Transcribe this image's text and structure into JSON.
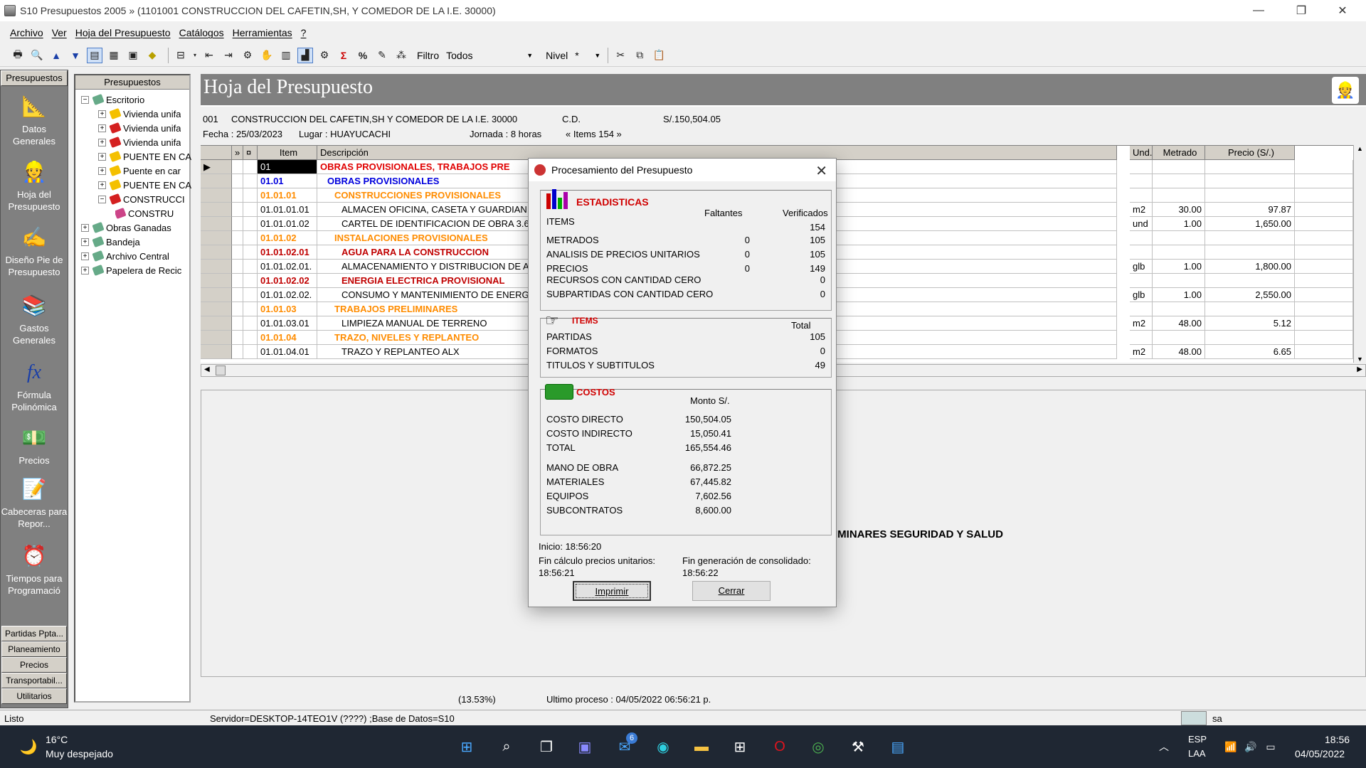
{
  "window": {
    "title": "S10 Presupuestos 2005 » (1101001 CONSTRUCCION DEL CAFETIN,SH, Y COMEDOR DE LA I.E. 30000)",
    "minimize": "—",
    "restore": "❐",
    "close": "✕"
  },
  "menu": [
    "Archivo",
    "Ver",
    "Hoja del Presupuesto",
    "Catálogos",
    "Herramientas",
    "?"
  ],
  "toolbar": {
    "filtro_label": "Filtro",
    "filtro_value": "Todos",
    "nivel_label": "Nivel",
    "nivel_value": "*"
  },
  "leftnav": {
    "header": "Presupuestos",
    "items": [
      {
        "label": "Datos Generales",
        "icon": "ruler-icon"
      },
      {
        "label": "Hoja del Presupuesto",
        "icon": "worker-icon"
      },
      {
        "label": "Diseño Pie de Presupuesto",
        "icon": "design-icon"
      },
      {
        "label": "Gastos Generales",
        "icon": "books-icon"
      },
      {
        "label": "Fórmula Polinómica",
        "icon": "formula-icon"
      },
      {
        "label": "Precios",
        "icon": "money-icon"
      },
      {
        "label": "Cabeceras para Repor...",
        "icon": "note-icon"
      },
      {
        "label": "Tiempos para Programació",
        "icon": "clock-icon"
      }
    ],
    "buttons": [
      "Partidas Ppta...",
      "Planeamiento",
      "Precios",
      "Transportabil...",
      "Utilitarios"
    ]
  },
  "tree": {
    "header": "Presupuestos",
    "items": [
      {
        "label": "Escritorio",
        "level": 0,
        "toggle": "−"
      },
      {
        "label": "Vivienda unifa",
        "level": 1,
        "toggle": "+"
      },
      {
        "label": "Vivienda unifa",
        "level": 1,
        "toggle": "+"
      },
      {
        "label": "Vivienda unifa",
        "level": 1,
        "toggle": "+"
      },
      {
        "label": "PUENTE EN CA",
        "level": 1,
        "toggle": "+"
      },
      {
        "label": "Puente en car",
        "level": 1,
        "toggle": "+"
      },
      {
        "label": "PUENTE EN CA",
        "level": 1,
        "toggle": "+"
      },
      {
        "label": "CONSTRUCCI",
        "level": 1,
        "toggle": "−"
      },
      {
        "label": "CONSTRU",
        "level": 2,
        "toggle": ""
      },
      {
        "label": "Obras Ganadas",
        "level": 0,
        "toggle": "+"
      },
      {
        "label": "Bandeja",
        "level": 0,
        "toggle": "+"
      },
      {
        "label": "Archivo Central",
        "level": 0,
        "toggle": "+"
      },
      {
        "label": "Papelera de Recic",
        "level": 0,
        "toggle": "+"
      }
    ]
  },
  "main": {
    "title": "Hoja del Presupuesto",
    "code": "001",
    "name": "CONSTRUCCION DEL CAFETIN,SH Y COMEDOR DE LA I.E. 30000",
    "cd": "C.D.",
    "amount": "S/.150,504.05",
    "fecha": "Fecha : 25/03/2023",
    "lugar": "Lugar :  HUAYUCACHI",
    "jornada": "Jornada :  8    horas",
    "items": "« Items 154 »",
    "columns": [
      "»",
      "¤",
      "Item",
      "Descripción",
      "Und.",
      "Metrado",
      "Precio (S/.)"
    ],
    "rows": [
      {
        "item": "01",
        "desc": "OBRAS PROVISIONALES, TRABAJOS PRE",
        "und": "",
        "met": "",
        "pre": "",
        "style": "c-red"
      },
      {
        "item": "01.01",
        "desc": "OBRAS PROVISIONALES",
        "und": "",
        "met": "",
        "pre": "",
        "style": "c-blue"
      },
      {
        "item": "01.01.01",
        "desc": "CONSTRUCCIONES PROVISIONALES",
        "und": "",
        "met": "",
        "pre": "",
        "style": "c-orange"
      },
      {
        "item": "01.01.01.01",
        "desc": "ALMACEN OFICINA, CASETA Y GUARDIAN",
        "und": "m2",
        "met": "30.00",
        "pre": "97.87",
        "style": ""
      },
      {
        "item": "01.01.01.02",
        "desc": "CARTEL DE IDENTIFICACION DE OBRA 3.60",
        "und": "und",
        "met": "1.00",
        "pre": "1,650.00",
        "style": ""
      },
      {
        "item": "01.01.02",
        "desc": "INSTALACIONES PROVISIONALES",
        "und": "",
        "met": "",
        "pre": "",
        "style": "c-orange"
      },
      {
        "item": "01.01.02.01",
        "desc": "AGUA PARA LA CONSTRUCCION",
        "und": "",
        "met": "",
        "pre": "",
        "style": "c-darkred"
      },
      {
        "item": "01.01.02.01.",
        "desc": "ALMACENAMIENTO Y DISTRIBUCION DE A",
        "und": "glb",
        "met": "1.00",
        "pre": "1,800.00",
        "style": ""
      },
      {
        "item": "01.01.02.02",
        "desc": "ENERGIA ELECTRICA PROVISIONAL",
        "und": "",
        "met": "",
        "pre": "",
        "style": "c-darkred"
      },
      {
        "item": "01.01.02.02.",
        "desc": "CONSUMO Y MANTENIMIENTO DE ENERG",
        "und": "glb",
        "met": "1.00",
        "pre": "2,550.00",
        "style": ""
      },
      {
        "item": "01.01.03",
        "desc": "TRABAJOS PRELIMINARES",
        "und": "",
        "met": "",
        "pre": "",
        "style": "c-orange"
      },
      {
        "item": "01.01.03.01",
        "desc": "LIMPIEZA MANUAL DE TERRENO",
        "und": "m2",
        "met": "48.00",
        "pre": "5.12",
        "style": ""
      },
      {
        "item": "01.01.04",
        "desc": "TRAZO, NIVELES Y REPLANTEO",
        "und": "",
        "met": "",
        "pre": "",
        "style": "c-orange"
      },
      {
        "item": "01.01.04.01",
        "desc": "TRAZO Y REPLANTEO ALX",
        "und": "m2",
        "met": "48.00",
        "pre": "6.65",
        "style": ""
      }
    ],
    "lower_text": "IMINARES SEGURIDAD Y SALUD",
    "percent": "(13.53%)",
    "ultimo": "Ultimo proceso : 04/05/2022 06:56:21 p."
  },
  "status": {
    "left": "Listo",
    "server": "Servidor=DESKTOP-14TEO1V (????) ;Base de Datos=S10",
    "user": "sa"
  },
  "dialog": {
    "title": "Procesamiento del Presupuesto",
    "estadisticas": {
      "title": "ESTADISTICAS",
      "col_falt": "Faltantes",
      "col_ver": "Verificados",
      "items_label": "ITEMS",
      "items_ver": "154",
      "rows": [
        {
          "label": "METRADOS",
          "falt": "0",
          "ver": "105"
        },
        {
          "label": "ANALISIS DE PRECIOS UNITARIOS",
          "falt": "0",
          "ver": "105"
        },
        {
          "label": "PRECIOS",
          "falt": "0",
          "ver": "149"
        }
      ],
      "rec_label": "RECURSOS CON CANTIDAD CERO",
      "rec_val": "0",
      "sub_label": "SUBPARTIDAS CON CANTIDAD CERO",
      "sub_val": "0"
    },
    "items": {
      "title": "ITEMS",
      "total": "Total",
      "rows": [
        {
          "label": "PARTIDAS",
          "val": "105"
        },
        {
          "label": "FORMATOS",
          "val": "0"
        },
        {
          "label": "TITULOS Y SUBTITULOS",
          "val": "49"
        }
      ]
    },
    "costos": {
      "title": "COSTOS",
      "monto": "Monto S/.",
      "rows1": [
        {
          "label": "COSTO DIRECTO",
          "val": "150,504.05"
        },
        {
          "label": "COSTO INDIRECTO",
          "val": "15,050.41"
        },
        {
          "label": "TOTAL",
          "val": "165,554.46"
        }
      ],
      "rows2": [
        {
          "label": "MANO DE OBRA",
          "val": "66,872.25"
        },
        {
          "label": "MATERIALES",
          "val": "67,445.82"
        },
        {
          "label": "EQUIPOS",
          "val": "7,602.56"
        },
        {
          "label": "SUBCONTRATOS",
          "val": "8,600.00"
        }
      ]
    },
    "inicio": "Inicio: 18:56:20",
    "fin_precios_label": "Fin cálculo precios unitarios:",
    "fin_precios": "18:56:21",
    "fin_consol_label": "Fin generación de consolidado:",
    "fin_consol": "18:56:22",
    "btn_imprimir": "Imprimir",
    "btn_cerrar": "Cerrar"
  },
  "taskbar": {
    "temp": "16°C",
    "weather": "Muy despejado",
    "lang1": "ESP",
    "lang2": "LAA",
    "time": "18:56",
    "date": "04/05/2022",
    "mail_badge": "6"
  }
}
